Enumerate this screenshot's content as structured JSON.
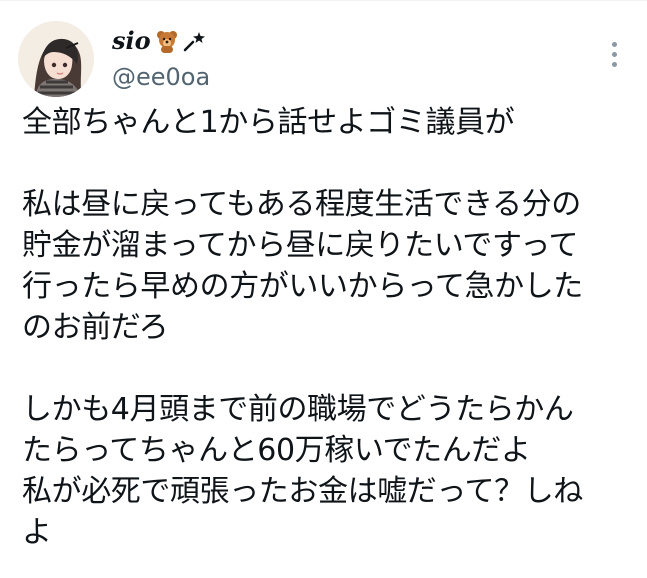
{
  "tweet": {
    "author": {
      "display_name": "sio",
      "handle": "@ee0oa",
      "name_icons": [
        "teddy-bear-emoji",
        "magic-wand-sparkle"
      ],
      "avatar": "anime-girl-portrait"
    },
    "menu_icon": "more-vertical-icon",
    "text_lines": [
      "全部ちゃんと1から話せよゴミ議員が",
      "",
      "私は昼に戻ってもある程度生活できる分の",
      "貯金が溜まってから昼に戻りたいですって",
      "行ったら早めの方がいいからって急かした",
      "のお前だろ",
      "",
      "しかも4月頭まで前の職場でどうたらかん",
      "たらってちゃんと60万稼いでたんだよ",
      "私が必死で頑張ったお金は嘘だって？しね",
      "よ"
    ]
  },
  "colors": {
    "text": "#0f1419",
    "handle": "#536471",
    "icon_gray": "#8b98a5",
    "background": "#ffffff"
  }
}
